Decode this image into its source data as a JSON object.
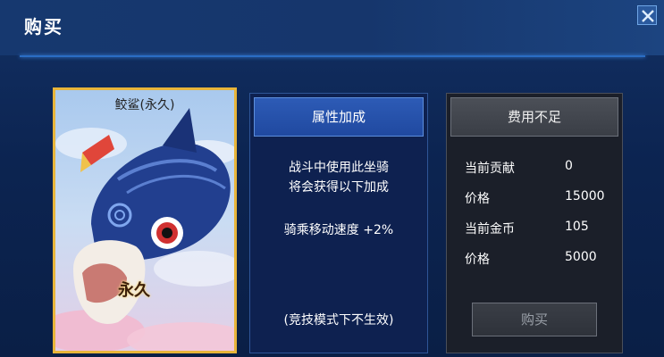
{
  "dialog": {
    "title": "购买"
  },
  "card": {
    "name": "鲛鲨(永久)",
    "badge": "永久"
  },
  "attributes": {
    "header": "属性加成",
    "line1": "战斗中使用此坐骑",
    "line2": "将会获得以下加成",
    "bonus": "骑乘移动速度  +2%",
    "note": "(竞技模式下不生效)"
  },
  "cost": {
    "header": "费用不足",
    "rows": [
      {
        "label": "当前贡献",
        "value": "0"
      },
      {
        "label": "价格",
        "value": "15000"
      },
      {
        "label": "当前金币",
        "value": "105"
      },
      {
        "label": "价格",
        "value": "5000"
      }
    ],
    "buy_label": "购买"
  },
  "colors": {
    "accent": "#2a6dc4",
    "card_border": "#e8b53a",
    "disabled_text": "#9aa0a8"
  },
  "icons": {
    "close": "close-icon"
  }
}
